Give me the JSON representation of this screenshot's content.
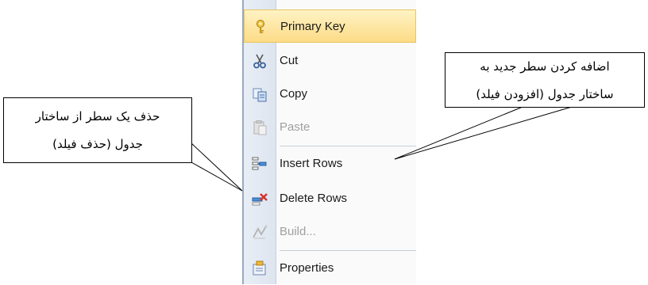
{
  "menu": {
    "items": [
      {
        "label": "Primary Key",
        "icon": "key-icon",
        "state": "highlighted"
      },
      {
        "label": "Cut",
        "icon": "scissors-icon",
        "state": "normal"
      },
      {
        "label": "Copy",
        "icon": "copy-icon",
        "state": "normal"
      },
      {
        "label": "Paste",
        "icon": "paste-icon",
        "state": "disabled"
      },
      {
        "label": "Insert Rows",
        "icon": "insert-rows-icon",
        "state": "normal"
      },
      {
        "label": "Delete Rows",
        "icon": "delete-rows-icon",
        "state": "normal"
      },
      {
        "label": "Build...",
        "icon": "build-icon",
        "state": "disabled"
      },
      {
        "label": "Properties",
        "icon": "properties-icon",
        "state": "normal"
      }
    ]
  },
  "callouts": {
    "insert": {
      "line1": "اضافه کردن سطر جدید به",
      "line2": "ساختار جدول (افزودن فیلد)"
    },
    "delete": {
      "line1": "حذف یک سطر از ساختار",
      "line2": "جدول (حذف فیلد)"
    }
  },
  "colors": {
    "highlight": "#fcdb86",
    "gutter": "#dde5ef",
    "delete_icon_red": "#d9342b"
  }
}
